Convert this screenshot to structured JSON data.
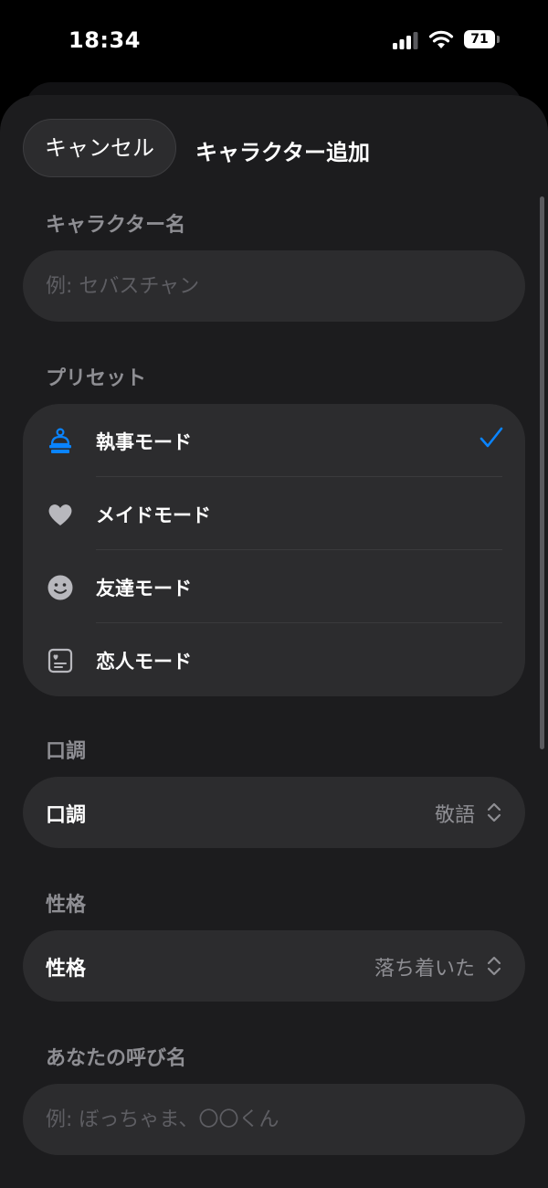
{
  "status": {
    "time": "18:34",
    "battery": "71"
  },
  "nav": {
    "cancel_label": "キャンセル",
    "title": "キャラクター追加"
  },
  "character_name": {
    "label": "キャラクター名",
    "placeholder": "例: セバスチャン"
  },
  "preset": {
    "label": "プリセット",
    "items": [
      {
        "label": "執事モード",
        "icon": "butler-bell-icon",
        "selected": true
      },
      {
        "label": "メイドモード",
        "icon": "heart-icon",
        "selected": false
      },
      {
        "label": "友達モード",
        "icon": "smiley-icon",
        "selected": false
      },
      {
        "label": "恋人モード",
        "icon": "photo-card-icon",
        "selected": false
      }
    ]
  },
  "tone": {
    "section_label": "口調",
    "row_label": "口調",
    "value": "敬語"
  },
  "personality": {
    "section_label": "性格",
    "row_label": "性格",
    "value": "落ち着いた"
  },
  "nickname": {
    "label": "あなたの呼び名",
    "placeholder": "例: ぼっちゃま、〇〇くん"
  },
  "colors": {
    "accent": "#0a84ff",
    "sheet": "#1c1c1e",
    "cell": "#2c2c2e",
    "secondary_text": "#8e8e93"
  }
}
